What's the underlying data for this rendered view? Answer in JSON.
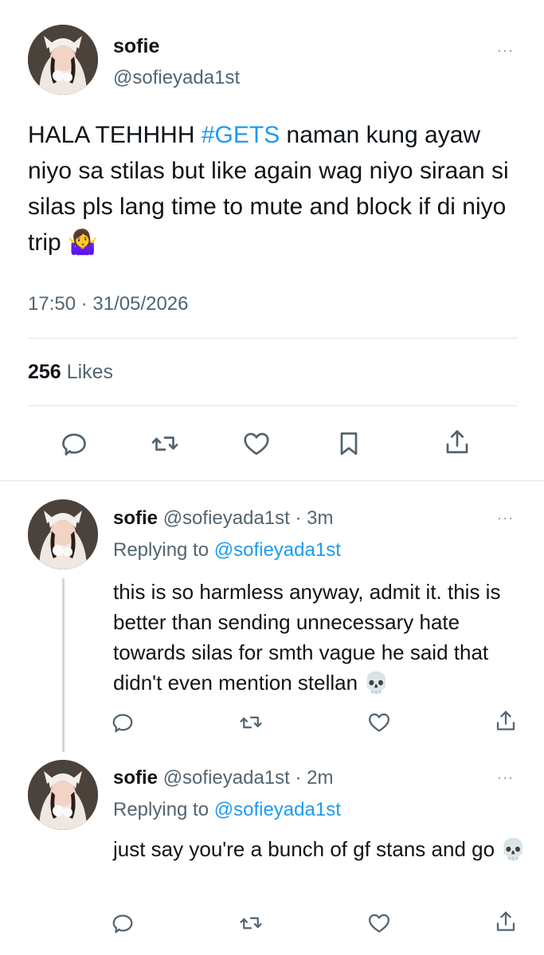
{
  "main_tweet": {
    "name": "sofie",
    "handle": "@sofieyada1st",
    "more": "···",
    "text_before": "HALA TEHHHH ",
    "hashtag": "#GETS",
    "text_after": " naman kung ayaw niyo sa stilas but like again wag niyo siraan si silas pls lang time to mute and block if di niyo trip ",
    "emoji": "🤷‍♀️",
    "timestamp": "17:50 · 31/05/2026",
    "likes_count": "256",
    "likes_label": "Likes"
  },
  "replies": [
    {
      "name": "sofie",
      "handle_time": "@sofieyada1st · 3m",
      "more": "···",
      "replying_prefix": "Replying to ",
      "replying_to": "@sofieyada1st",
      "text": "this is so harmless anyway, admit it. this is better than sending unnecessary hate towards silas for smth vague he said that didn't even mention stellan ",
      "emoji": "💀"
    },
    {
      "name": "sofie",
      "handle_time": "@sofieyada1st · 2m",
      "more": "···",
      "replying_prefix": "Replying to ",
      "replying_to": "@sofieyada1st",
      "text": "just say you're a bunch of gf stans and go ",
      "emoji": "💀"
    }
  ],
  "icons": {
    "reply": "reply-icon",
    "retweet": "retweet-icon",
    "like": "like-icon",
    "bookmark": "bookmark-icon",
    "share": "share-icon"
  },
  "colors": {
    "text": "#0f1419",
    "secondary": "#536471",
    "link": "#1d9bf0",
    "divider": "#e1e6ea"
  }
}
